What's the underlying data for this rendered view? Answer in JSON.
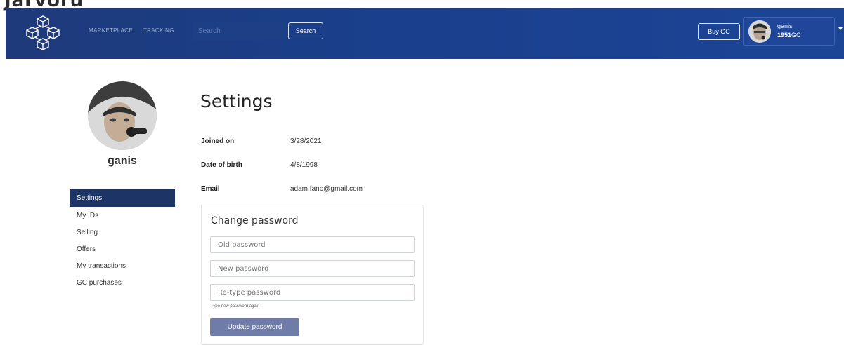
{
  "header": {
    "nav_links": [
      "MARKETPLACE",
      "TRACKING"
    ],
    "search_placeholder": "Search",
    "search_button": "Search",
    "buy_gc_button": "Buy GC",
    "user": {
      "name": "ganis",
      "gc_amount": "1951",
      "gc_unit": "GC"
    }
  },
  "colors": {
    "navbar": "#1c3f8a",
    "active_nav": "#1d3466",
    "update_button": "#6f7ca8"
  },
  "icons": {
    "logo": "cube-network-icon",
    "dropdown": "caret-down-icon"
  },
  "profile": {
    "name": "ganis"
  },
  "sidebar": {
    "items": [
      {
        "label": "Settings",
        "active": true
      },
      {
        "label": "My IDs",
        "active": false
      },
      {
        "label": "Selling",
        "active": false
      },
      {
        "label": "Offers",
        "active": false
      },
      {
        "label": "My transactions",
        "active": false
      },
      {
        "label": "GC purchases",
        "active": false
      }
    ]
  },
  "main": {
    "title": "Settings",
    "info": [
      {
        "label": "Joined on",
        "value": "3/28/2021"
      },
      {
        "label": "Date of birth",
        "value": "4/8/1998"
      },
      {
        "label": "Email",
        "value": "adam.fano@gmail.com"
      }
    ],
    "change_password": {
      "title": "Change password",
      "old_placeholder": "Old password",
      "new_placeholder": "New password",
      "retype_placeholder": "Re-type password",
      "hint": "Type new password again",
      "button": "Update password"
    }
  }
}
